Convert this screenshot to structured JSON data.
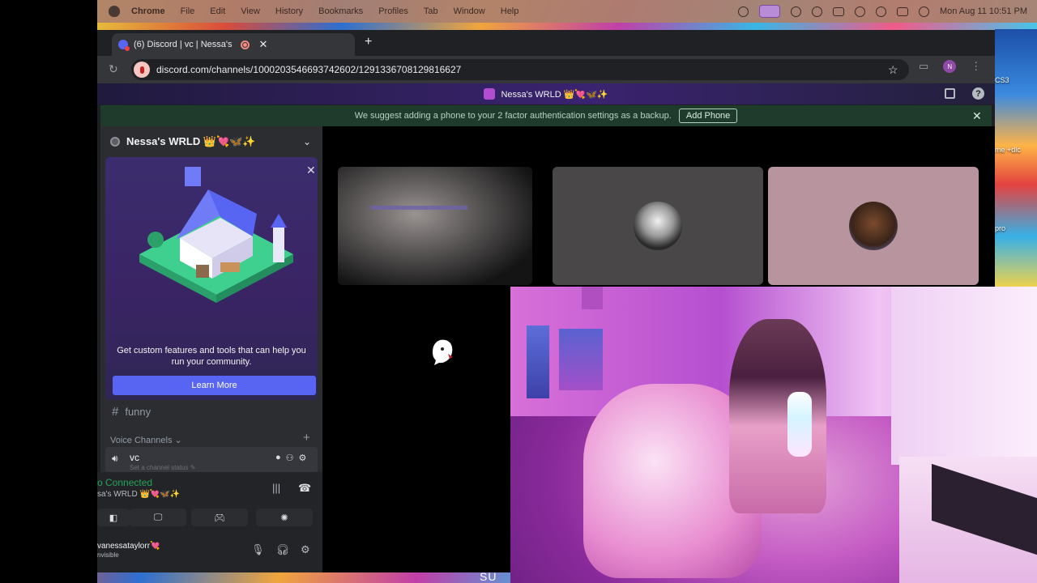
{
  "menubar": {
    "app": "Chrome",
    "menus": [
      "File",
      "Edit",
      "View",
      "History",
      "Bookmarks",
      "Profiles",
      "Tab",
      "Window",
      "Help"
    ],
    "datetime": "Mon Aug 11  10:51 PM"
  },
  "browser": {
    "tab_title": "(6) Discord | vc | Nessa's",
    "new_tab": "+",
    "tab_close": "✕",
    "url": "discord.com/channels/1000203546693742602/1291336708129816627",
    "profile_initial": "N"
  },
  "discord": {
    "title": "Nessa's WRLD 👑💘🦋✨",
    "help": "?",
    "notice": {
      "text": "We suggest adding a phone to your 2 factor authentication settings as a backup.",
      "button": "Add Phone",
      "close": "✕"
    },
    "server_name": "Nessa's WRLD 👑💘🦋✨",
    "promo": {
      "text": "Get custom features and tools that can help you run your community.",
      "button": "Learn More",
      "close": "✕"
    },
    "channels": {
      "text_channel": "funny",
      "hash": "#",
      "voice_category": "Voice Channels",
      "voice_channel": "vc",
      "voice_status": "Set a channel status ✎",
      "add": "+"
    },
    "voice_panel": {
      "connected": "o Connected",
      "server": "sa's WRLD 👑💘🦋✨"
    },
    "user": {
      "name": "vanessataylorr💘",
      "status": "nvisible"
    }
  },
  "desktop": {
    "dock_labels": [
      "CS3",
      "me +dlc",
      "pro"
    ],
    "bottom_word": "SU"
  }
}
